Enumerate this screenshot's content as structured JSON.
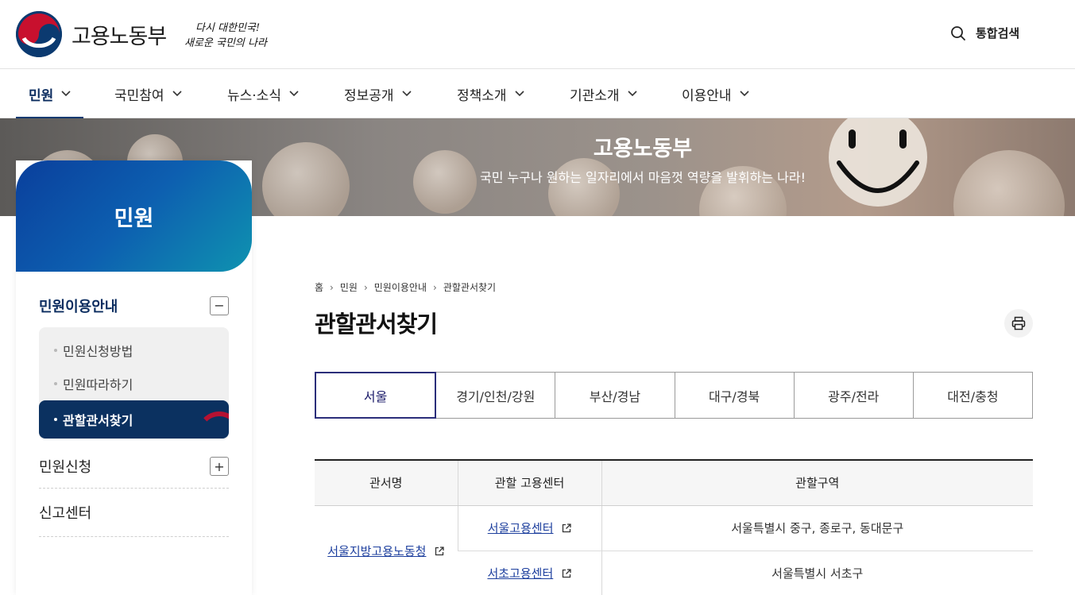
{
  "header": {
    "logo_text": "고용노동부",
    "slogan_line1": "다시 대한민국!",
    "slogan_line2": "새로운 국민의 나라",
    "search_label": "통합검색"
  },
  "gnb": {
    "items": [
      {
        "label": "민원"
      },
      {
        "label": "국민참여"
      },
      {
        "label": "뉴스·소식"
      },
      {
        "label": "정보공개"
      },
      {
        "label": "정책소개"
      },
      {
        "label": "기관소개"
      },
      {
        "label": "이용안내"
      }
    ]
  },
  "banner": {
    "title": "고용노동부",
    "subtitle": "국민 누구나 원하는 일자리에서 마음껏 역량을 발휘하는 나라!"
  },
  "lnb": {
    "title": "민원",
    "groups": [
      {
        "label": "민원이용안내",
        "toggle": "−"
      },
      {
        "label": "민원신청",
        "toggle": "+"
      },
      {
        "label": "신고센터"
      }
    ],
    "sub_items": [
      {
        "label": "민원신청방법"
      },
      {
        "label": "민원따라하기"
      },
      {
        "label": "관할관서찾기"
      }
    ]
  },
  "breadcrumb": [
    "홈",
    "민원",
    "민원이용안내",
    "관할관서찾기"
  ],
  "page_title": "관할관서찾기",
  "tabs": [
    "서울",
    "경기/인천/강원",
    "부산/경남",
    "대구/경북",
    "광주/전라",
    "대전/충청"
  ],
  "table": {
    "headers": [
      "관서명",
      "관할 고용센터",
      "관할구역"
    ],
    "office": "서울지방고용노동청",
    "rows": [
      {
        "center": "서울고용센터",
        "area": "서울특별시 중구, 종로구, 동대문구"
      },
      {
        "center": "서초고용센터",
        "area": "서울특별시 서초구"
      }
    ]
  },
  "colors": {
    "primary": "#0b3a70",
    "link": "#1d3f9e",
    "active_tab_border": "#2b2e7a",
    "accent_red": "#c8102e"
  }
}
